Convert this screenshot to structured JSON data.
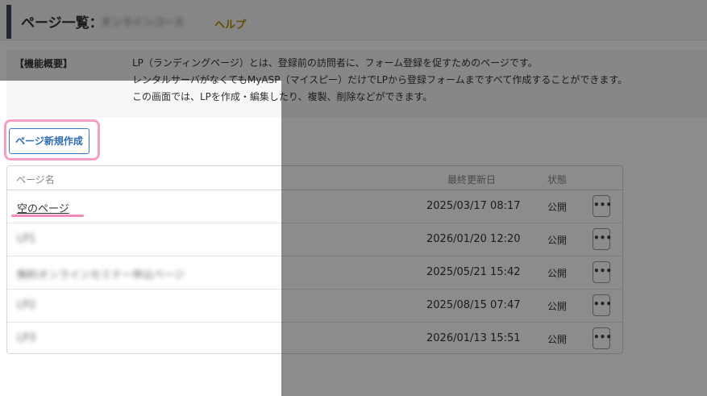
{
  "header": {
    "title": "ページ一覧：",
    "account_name": "オンラインコース",
    "help_label": "ヘルプ"
  },
  "description": {
    "label": "【機能概要】",
    "lines": [
      "LP（ランディングページ）とは、登録前の訪問者に、フォーム登録を促すためのページです。",
      "レンタルサーバがなくてもMyASP（マイスピー）だけでLPから登録フォームまですべて作成することができます。",
      "この画面では、LPを作成・編集したり、複製、削除などができます。"
    ]
  },
  "new_page_button": "ページ新規作成",
  "table": {
    "headers": {
      "name": "ページ名",
      "updated": "最終更新日",
      "status": "状態"
    },
    "more_label": "•••",
    "rows": [
      {
        "name": "空のページ",
        "updated": "2025/03/17 08:17",
        "status": "公開"
      },
      {
        "name": "LP1",
        "updated": "2026/01/20 12:20",
        "status": "公開"
      },
      {
        "name": "無料オンラインセミナー申込ページ",
        "updated": "2025/05/21 15:42",
        "status": "公開"
      },
      {
        "name": "LP2",
        "updated": "2025/08/15 07:47",
        "status": "公開"
      },
      {
        "name": "LP3",
        "updated": "2026/01/13 15:51",
        "status": "公開"
      }
    ]
  },
  "colors": {
    "highlight": "#f4a0c6",
    "button_border": "#3a7bc8",
    "help_link": "#b48a00"
  }
}
